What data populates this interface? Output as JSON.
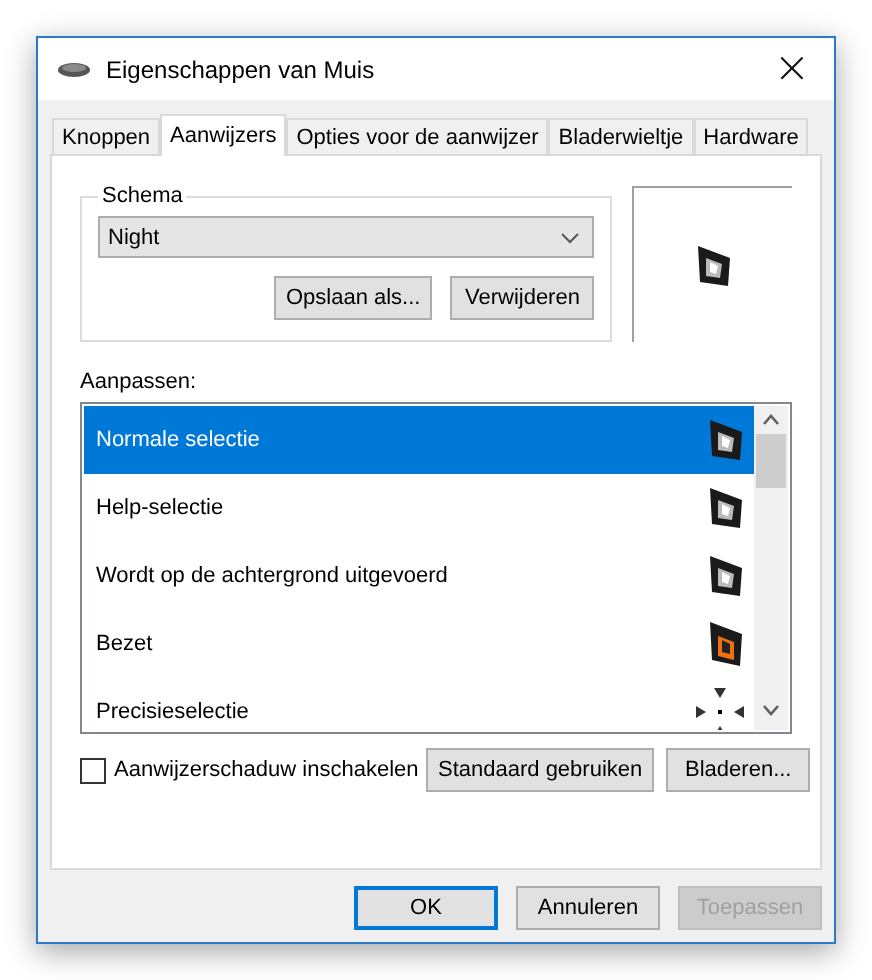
{
  "window": {
    "title": "Eigenschappen van Muis",
    "close": "×"
  },
  "tabs": [
    {
      "label": "Knoppen",
      "selected": false
    },
    {
      "label": "Aanwijzers",
      "selected": true
    },
    {
      "label": "Opties voor de aanwijzer",
      "selected": false
    },
    {
      "label": "Bladerwieltje",
      "selected": false
    },
    {
      "label": "Hardware",
      "selected": false
    }
  ],
  "scheme": {
    "legend": "Schema",
    "value": "Night",
    "buttons": [
      "Opslaan als...",
      "Verwijderen"
    ]
  },
  "customize": {
    "label": "Aanpassen:",
    "rows": [
      {
        "label": "Normale selectie",
        "kind": "arrow",
        "selected": true
      },
      {
        "label": "Help-selectie",
        "kind": "arrow",
        "selected": false
      },
      {
        "label": "Wordt op de achtergrond uitgevoerd",
        "kind": "arrow",
        "selected": false
      },
      {
        "label": "Bezet",
        "kind": "busy",
        "selected": false
      },
      {
        "label": "Precisieselectie",
        "kind": "precision",
        "selected": false
      }
    ]
  },
  "shadow": {
    "label": "Aanwijzerschaduw inschakelen",
    "checked": false
  },
  "list_buttons": [
    "Standaard gebruiken",
    "Bladeren..."
  ],
  "footer": [
    {
      "label": "OK",
      "disabled": false,
      "default": true
    },
    {
      "label": "Annuleren",
      "disabled": false,
      "default": false
    },
    {
      "label": "Toepassen",
      "disabled": true,
      "default": false
    }
  ]
}
